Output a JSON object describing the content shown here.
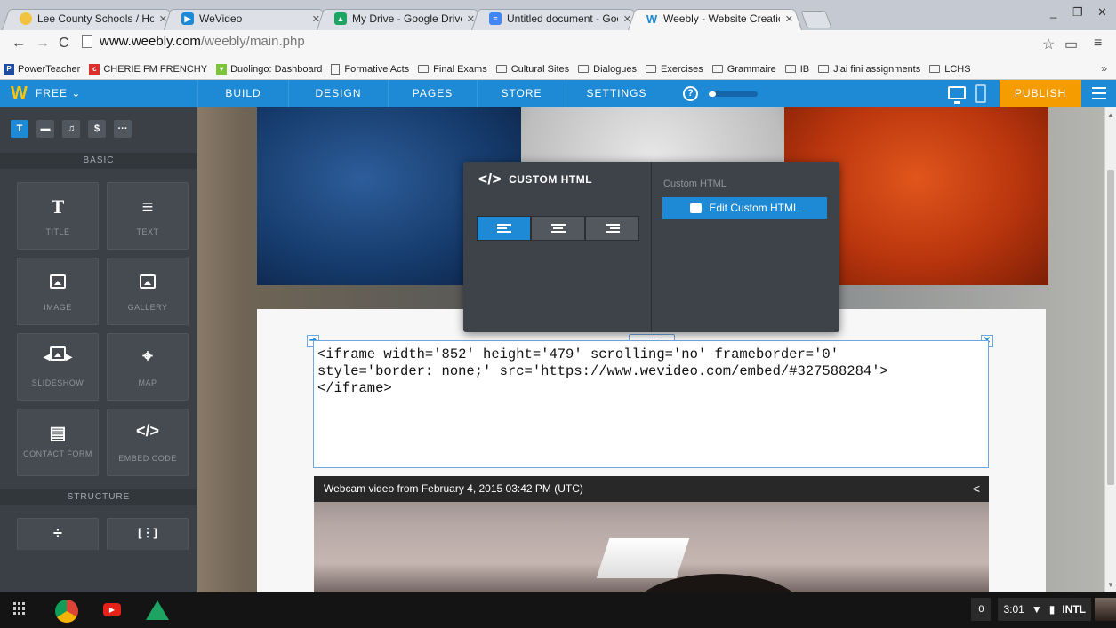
{
  "browser": {
    "tabs": [
      {
        "title": "Lee County Schools / Hor",
        "favicon_color": "#f2c341",
        "favicon_glyph": ""
      },
      {
        "title": "WeVideo",
        "favicon_color": "#1e8ad6",
        "favicon_glyph": "▶"
      },
      {
        "title": "My Drive - Google Drive",
        "favicon_color": "#1da462",
        "favicon_glyph": "▲"
      },
      {
        "title": "Untitled document - Goo",
        "favicon_color": "#4285f4",
        "favicon_glyph": "≡"
      },
      {
        "title": "Weebly - Website Creatic",
        "favicon_color": "#1e8ad6",
        "favicon_glyph": "W"
      }
    ],
    "active_tab_index": 4,
    "url_host": "www.weebly.com",
    "url_path": "/weebly/main.php"
  },
  "bookmarks": [
    {
      "label": "PowerTeacher",
      "kind": "site",
      "color": "#1f4ba0",
      "glyph": "P"
    },
    {
      "label": "CHERIE FM FRENCHY",
      "kind": "site",
      "color": "#d9302c",
      "glyph": "c"
    },
    {
      "label": "Duolingo: Dashboard",
      "kind": "site",
      "color": "#7cc43a",
      "glyph": "♥"
    },
    {
      "label": "Formative Acts",
      "kind": "page"
    },
    {
      "label": "Final Exams",
      "kind": "folder"
    },
    {
      "label": "Cultural Sites",
      "kind": "folder"
    },
    {
      "label": "Dialogues",
      "kind": "folder"
    },
    {
      "label": "Exercises",
      "kind": "folder"
    },
    {
      "label": "Grammaire",
      "kind": "folder"
    },
    {
      "label": "IB",
      "kind": "folder"
    },
    {
      "label": "J'ai fini assignments",
      "kind": "folder"
    },
    {
      "label": "LCHS",
      "kind": "folder"
    }
  ],
  "weebly": {
    "plan": "FREE",
    "nav": [
      "BUILD",
      "DESIGN",
      "PAGES",
      "STORE",
      "SETTINGS"
    ],
    "help_glyph": "?",
    "publish": "PUBLISH",
    "setup_progress": 0.15
  },
  "panel": {
    "tab_glyphs": [
      "T",
      "▬",
      "♫",
      "$",
      "···"
    ],
    "section_basic": "BASIC",
    "section_structure": "STRUCTURE",
    "elements": [
      {
        "label": "TITLE",
        "glyph": "T"
      },
      {
        "label": "TEXT",
        "glyph": "≡"
      },
      {
        "label": "IMAGE",
        "glyph": "image"
      },
      {
        "label": "GALLERY",
        "glyph": "gallery"
      },
      {
        "label": "SLIDESHOW",
        "glyph": "slideshow"
      },
      {
        "label": "MAP",
        "glyph": "map-pin"
      },
      {
        "label": "CONTACT FORM",
        "glyph": "form"
      },
      {
        "label": "EMBED CODE",
        "glyph": "</>"
      }
    ],
    "structure_glyphs": [
      "÷",
      "[⋮]"
    ]
  },
  "popup": {
    "tag": "</>",
    "title": "CUSTOM HTML",
    "subtitle": "Custom HTML",
    "button": "Edit Custom HTML"
  },
  "editor": {
    "code": "<iframe width='852' height='479' scrolling='no' frameborder='0'\nstyle='border: none;' src='https://www.wevideo.com/embed/#327588284'>\n</iframe>",
    "handle_glyph": "::::",
    "corner_left": "➜",
    "corner_right": "✕"
  },
  "video": {
    "caption": "Webcam video from February 4, 2015 03:42 PM (UTC)",
    "share_glyph": "<"
  },
  "taskbar": {
    "notifications": "0",
    "time": "3:01",
    "locale": "INTL"
  }
}
